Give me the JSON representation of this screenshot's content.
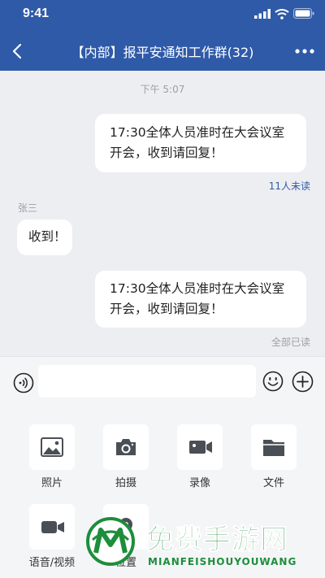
{
  "status": {
    "time": "9:41"
  },
  "header": {
    "title": "【内部】报平安通知工作群(32)"
  },
  "chat": {
    "timestamp": "下午 5:07",
    "messages": [
      {
        "text_line1": "17:30全体人员准时在大会议室",
        "text_line2": "开会，收到请回复！",
        "read_status": "11人未读"
      },
      {
        "sender": "张三",
        "text": "收到！"
      },
      {
        "text_line1": "17:30全体人员准时在大会议室",
        "text_line2": "开会，收到请回复！",
        "read_status": "全部已读"
      }
    ]
  },
  "input": {
    "value": "",
    "placeholder": ""
  },
  "panel": {
    "items": [
      {
        "label": "照片",
        "icon": "image-icon"
      },
      {
        "label": "拍摄",
        "icon": "camera-icon"
      },
      {
        "label": "录像",
        "icon": "video-camera-icon"
      },
      {
        "label": "文件",
        "icon": "folder-icon"
      },
      {
        "label": "语音/视频",
        "icon": "video-call-icon"
      },
      {
        "label": "位置",
        "icon": "location-icon"
      }
    ]
  },
  "watermark": {
    "cn": "免费手游网",
    "en": "MIANFEISHOUYOUWANG"
  },
  "colors": {
    "header": "#2f5aa8",
    "unread": "#2f5aa8",
    "watermark": "#1d8e3a"
  }
}
